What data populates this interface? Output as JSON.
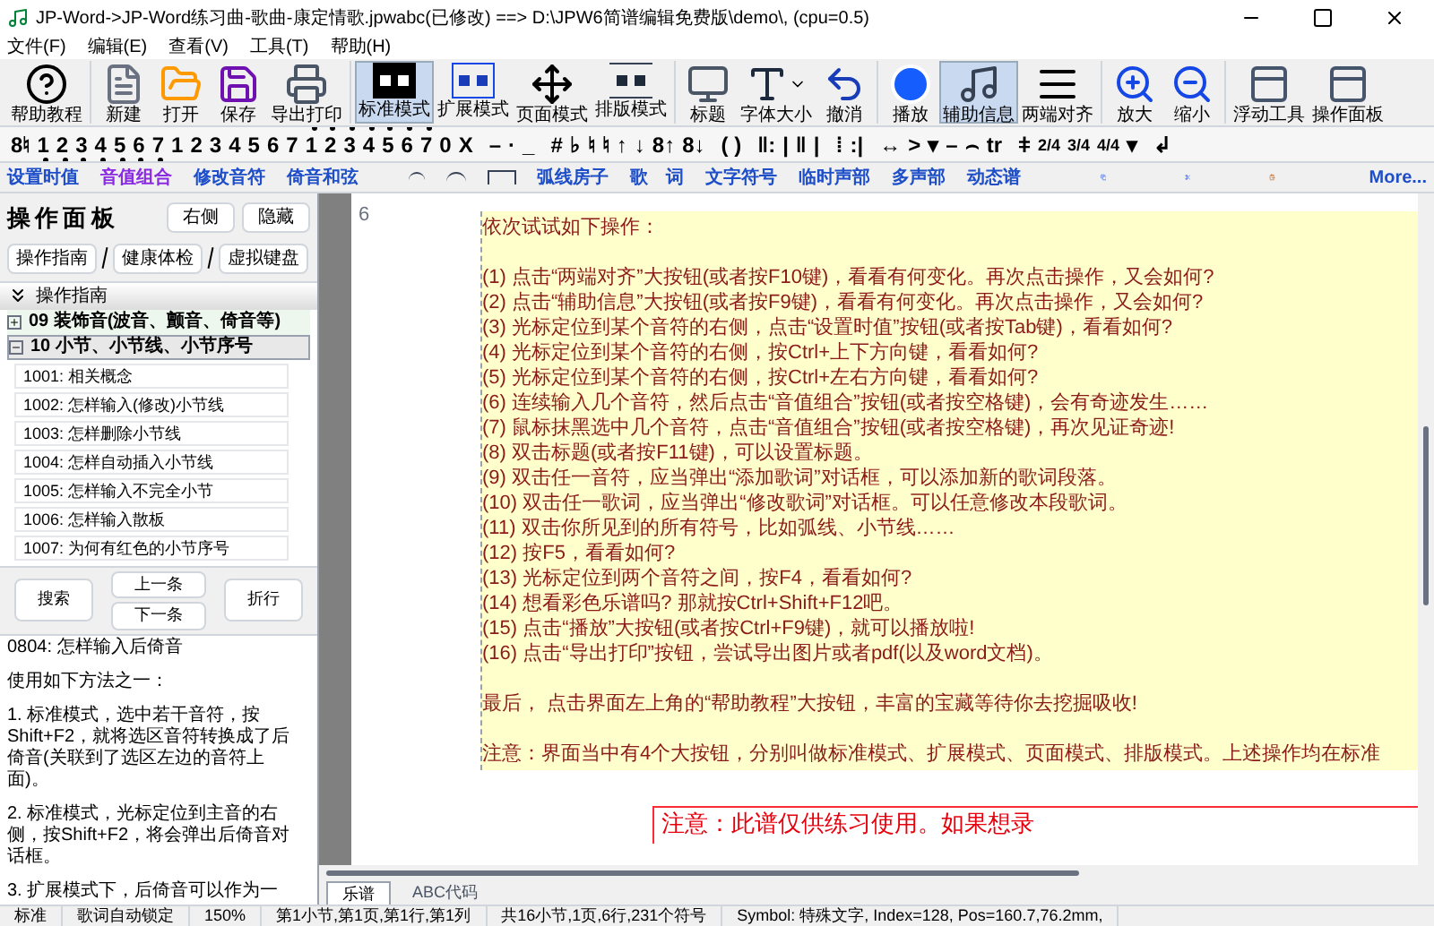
{
  "window": {
    "title": "JP-Word->JP-Word练习曲-歌曲-康定情歌.jpwabc(已修改) ==> D:\\JPW6简谱编辑免费版\\demo\\, (cpu=0.5)"
  },
  "menu": [
    "文件(F)",
    "编辑(E)",
    "查看(V)",
    "工具(T)",
    "帮助(H)"
  ],
  "toolbar": [
    {
      "label": "帮助教程",
      "selected": false
    },
    {
      "label": "新建",
      "selected": false
    },
    {
      "label": "打开",
      "selected": false
    },
    {
      "label": "保存",
      "selected": false
    },
    {
      "label": "导出打印",
      "selected": false
    },
    {
      "label": "标准模式",
      "selected": true
    },
    {
      "label": "扩展模式",
      "selected": false
    },
    {
      "label": "页面模式",
      "selected": false
    },
    {
      "label": "排版模式",
      "selected": false
    },
    {
      "label": "标题",
      "selected": false
    },
    {
      "label": "字体大小",
      "selected": false,
      "dropdown": true
    },
    {
      "label": "撤消",
      "selected": false
    },
    {
      "label": "播放",
      "selected": false
    },
    {
      "label": "辅助信息",
      "selected": true
    },
    {
      "label": "两端对齐",
      "selected": false
    },
    {
      "label": "放大",
      "selected": false
    },
    {
      "label": "缩小",
      "selected": false
    },
    {
      "label": "浮动工具",
      "selected": false
    },
    {
      "label": "操作面板",
      "selected": false
    }
  ],
  "symbols": [
    {
      "text": "8♮",
      "kind": "plain"
    },
    {
      "text": "1",
      "kind": "low"
    },
    {
      "text": "2",
      "kind": "low"
    },
    {
      "text": "3",
      "kind": "low"
    },
    {
      "text": "4",
      "kind": "low"
    },
    {
      "text": "5",
      "kind": "low"
    },
    {
      "text": "6",
      "kind": "low"
    },
    {
      "text": "7",
      "kind": "low"
    },
    {
      "text": "1",
      "kind": "plain"
    },
    {
      "text": "2",
      "kind": "plain"
    },
    {
      "text": "3",
      "kind": "plain"
    },
    {
      "text": "4",
      "kind": "plain"
    },
    {
      "text": "5",
      "kind": "plain"
    },
    {
      "text": "6",
      "kind": "plain"
    },
    {
      "text": "7",
      "kind": "plain"
    },
    {
      "text": "1",
      "kind": "high"
    },
    {
      "text": "2",
      "kind": "high"
    },
    {
      "text": "3",
      "kind": "high"
    },
    {
      "text": "4",
      "kind": "high"
    },
    {
      "text": "5",
      "kind": "high"
    },
    {
      "text": "6",
      "kind": "high"
    },
    {
      "text": "7",
      "kind": "high"
    },
    {
      "text": "0",
      "kind": "plain"
    },
    {
      "text": "X",
      "kind": "plain"
    },
    {
      "text": "–",
      "kind": "sep"
    },
    {
      "text": "·",
      "kind": "plain"
    },
    {
      "text": "_",
      "kind": "plain"
    },
    {
      "text": "#",
      "kind": "sep"
    },
    {
      "text": "♭",
      "kind": "plain"
    },
    {
      "text": "♮",
      "kind": "plain"
    },
    {
      "text": "♮",
      "kind": "plain"
    },
    {
      "text": "↑",
      "kind": "plain"
    },
    {
      "text": "↓",
      "kind": "plain"
    },
    {
      "text": "8↑",
      "kind": "plain"
    },
    {
      "text": "8↓",
      "kind": "plain"
    },
    {
      "text": "( )",
      "kind": "sep"
    },
    {
      "text": "‖:",
      "kind": "sep"
    },
    {
      "text": "|",
      "kind": "plain"
    },
    {
      "text": "‖",
      "kind": "plain"
    },
    {
      "text": "|",
      "kind": "plain"
    },
    {
      "text": "⁞",
      "kind": "sep"
    },
    {
      "text": ":|",
      "kind": "plain"
    },
    {
      "text": "↔",
      "kind": "sep"
    },
    {
      "text": ">",
      "kind": "plain"
    },
    {
      "text": "▾",
      "kind": "plain"
    },
    {
      "text": "–",
      "kind": "plain"
    },
    {
      "text": "⌢",
      "kind": "plain"
    },
    {
      "text": "tr",
      "kind": "plain"
    },
    {
      "text": "ǂ",
      "kind": "sep"
    },
    {
      "text": "2/4",
      "kind": "time"
    },
    {
      "text": "3/4",
      "kind": "time"
    },
    {
      "text": "4/4",
      "kind": "time"
    },
    {
      "text": "▾",
      "kind": "plain"
    },
    {
      "text": "↲",
      "kind": "sep"
    }
  ],
  "actions": [
    {
      "text": "设置时值",
      "color": "#1f4fc8"
    },
    {
      "text": "音值组合",
      "color": "#8a2be2"
    },
    {
      "text": "修改音符",
      "color": "#1f4fc8"
    },
    {
      "text": "倚音和弦",
      "color": "#1f4fc8"
    },
    {
      "text": "弧线房子",
      "color": "#1f4fc8"
    },
    {
      "text": "歌　词",
      "color": "#1f4fc8"
    },
    {
      "text": "文字符号",
      "color": "#1f4fc8"
    },
    {
      "text": "临时声部",
      "color": "#1f4fc8"
    },
    {
      "text": "多声部",
      "color": "#1f4fc8"
    },
    {
      "text": "动态谱",
      "color": "#1f4fc8"
    }
  ],
  "more": "More...",
  "panel": {
    "title": "操作面板",
    "buttons": [
      "右侧",
      "隐藏"
    ],
    "tabs": [
      "操作指南",
      "健康体检",
      "虚拟键盘"
    ],
    "section": "操作指南",
    "tree": [
      {
        "label": "09 装饰音(波音、颤音、倚音等)",
        "expanded": false
      },
      {
        "label": "10 小节、小节线、小节序号",
        "expanded": true,
        "children": [
          {
            "label": "1001: 相关概念"
          },
          {
            "label": "1002: 怎样输入(修改)小节线"
          },
          {
            "label": "1003: 怎样删除小节线"
          },
          {
            "label": "1004: 怎样自动插入小节线"
          },
          {
            "label": "1005: 怎样输入不完全小节"
          },
          {
            "label": "1006: 怎样输入散板"
          },
          {
            "label": "1007: 为何有红色的小节序号"
          }
        ]
      }
    ],
    "nav": {
      "search": "搜索",
      "prev": "上一条",
      "next": "下一条",
      "wrap": "折行"
    },
    "help": [
      "0804: 怎样输入后倚音",
      "使用如下方法之一：",
      "1. 标准模式，选中若干音符，按Shift+F2，就将选区音符转换成了后倚音(关联到了选区左边的音符上面)。",
      "2. 标准模式，光标定位到主音的右侧，按Shift+F2，将会弹出后倚音对话框。",
      "3. 扩展模式下，后倚音可以作为一"
    ]
  },
  "editor": {
    "line_number": "6",
    "paragraphs": [
      [
        "依次试试如下操作："
      ],
      [
        "(1) 点击“两端对齐”大按钮(或者按F10键)，看看有何变化。再次点击操作，又会如何?",
        "(2) 点击“辅助信息”大按钮(或者按F9键)，看看有何变化。再次点击操作，又会如何?",
        "(3) 光标定位到某个音符的右侧，点击“设置时值”按钮(或者按Tab键)，看看如何?",
        "(4) 光标定位到某个音符的右侧，按Ctrl+上下方向键，看看如何?",
        "(5) 光标定位到某个音符的右侧，按Ctrl+左右方向键，看看如何?",
        "(6) 连续输入几个音符，然后点击“音值组合”按钮(或者按空格键)，会有奇迹发生……",
        "(7) 鼠标抹黑选中几个音符，点击“音值组合”按钮(或者按空格键)，再次见证奇迹!",
        "(8) 双击标题(或者按F11键)，可以设置标题。",
        "(9) 双击任一音符，应当弹出“添加歌词”对话框，可以添加新的歌词段落。",
        "(10) 双击任一歌词，应当弹出“修改歌词”对话框。可以任意修改本段歌词。",
        "(11) 双击你所见到的所有符号，比如弧线、小节线……",
        "(12) 按F5，看看如何?",
        "(13) 光标定位到两个音符之间，按F4，看看如何?",
        "(14) 想看彩色乐谱吗? 那就按Ctrl+Shift+F12吧。",
        "(15) 点击“播放”大按钮(或者按Ctrl+F9键)，就可以播放啦!",
        "(16) 点击“导出打印”按钮，尝试导出图片或者pdf(以及word文档)。"
      ],
      [
        "最后， 点击界面左上角的“帮助教程”大按钮，丰富的宝藏等待你去挖掘吸收!"
      ],
      [
        "注意：界面当中有4个大按钮，分别叫做标准模式、扩展模式、页面模式、排版模式。上述操作均在标准"
      ]
    ],
    "notice": "注意：此谱仅供练习使用。如果想录",
    "tabs": [
      {
        "label": "乐谱",
        "selected": true
      },
      {
        "label": "ABC代码",
        "selected": false
      }
    ]
  },
  "status_bar": [
    "标准",
    "歌词自动锁定",
    "150%",
    "第1小节,第1页,第1行,第1列",
    "共16小节,1页,6行,231个符号",
    "Symbol: 特殊文字, Index=128, Pos=160.7,76.2mm,"
  ]
}
